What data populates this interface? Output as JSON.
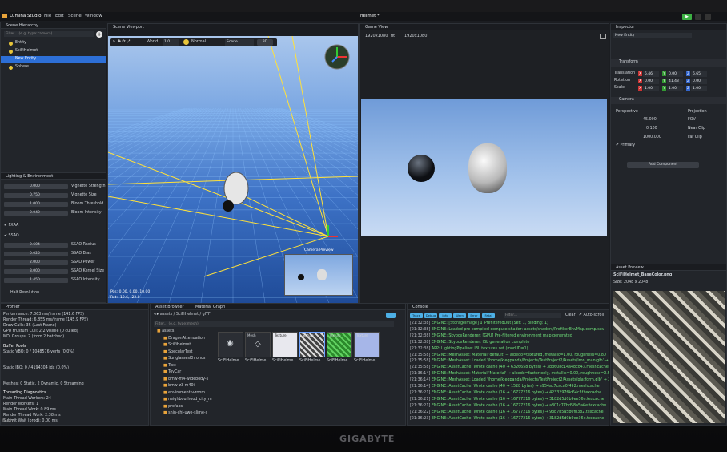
{
  "app": {
    "name": "Lumina Studio",
    "menu": [
      "File",
      "Edit",
      "Scene",
      "Window"
    ],
    "doc_title": "helmet *"
  },
  "hierarchy": {
    "title": "Scene Hierarchy",
    "search_placeholder": "Filter... (e.g. type:camera)",
    "items": [
      "Entity",
      "SciFiHelmet",
      "New Entity",
      "Sphere"
    ]
  },
  "viewport": {
    "title": "Scene Viewport",
    "mode": "World",
    "value": "1.0",
    "shading": "Normal",
    "view": "Scene",
    "dim": "3D",
    "camera_preview": "Camera Preview",
    "stats": [
      "Pos: 0.00, 0.00, 10.00",
      "Rot: -19.6, -22.0"
    ]
  },
  "gameview": {
    "title": "Game View",
    "res_label": "1920x1080",
    "fit": "fit",
    "res_value": "1920x1080"
  },
  "inspector": {
    "title": "Inspector",
    "entity": "New Entity",
    "transform": "Transform",
    "rows": [
      {
        "label": "Translation",
        "x": "5.46",
        "y": "0.00",
        "z": "6.65"
      },
      {
        "label": "Rotation",
        "x": "0.00",
        "y": "41.43",
        "z": "0.00"
      },
      {
        "label": "Scale",
        "x": "1.00",
        "y": "1.00",
        "z": "1.00"
      }
    ],
    "camera": "Camera",
    "perspective": "Perspective",
    "projection": "Projection",
    "cam_rows": [
      {
        "v": "45.000",
        "l": "FOV"
      },
      {
        "v": "0.100",
        "l": "Near Clip"
      },
      {
        "v": "1000.000",
        "l": "Far Clip"
      }
    ],
    "primary": "Primary",
    "add_component": "Add Component"
  },
  "lighting": {
    "title": "Lighting & Environment",
    "rows": [
      {
        "v": "0.000",
        "l": "Vignette Strength"
      },
      {
        "v": "0.750",
        "l": "Vignette Size"
      },
      {
        "v": "1.000",
        "l": "Bloom Threshold"
      },
      {
        "v": "0.040",
        "l": "Bloom Intensity"
      }
    ],
    "fxaa": "FXAA",
    "ssao": "SSAO",
    "ssao_rows": [
      {
        "v": "0.604",
        "l": "SSAO Radius"
      },
      {
        "v": "0.025",
        "l": "SSAO Bias"
      },
      {
        "v": "2.000",
        "l": "SSAO Power"
      },
      {
        "v": "3.000",
        "l": "SSAO Kernel Size"
      },
      {
        "v": "1.450",
        "l": "SSAO Intensity"
      }
    ],
    "half_res": "Half Resolution"
  },
  "profiler": {
    "title": "Profiler",
    "lines": [
      "Performance: 7.063 ms/frame (141.6 FPS)",
      "Render Thread: 6.855 ms/frame (145.9 FPS)",
      "Draw Calls: 35 (Last Frame)",
      "GPU Frustum Cull: 2/2 visible (0 culled)",
      "MDI Groups: 2 (from 2 batched)"
    ],
    "buffer_pools": "Buffer Pools",
    "static_vbo": "Static VBO: 0 / 1048576 verts (0.0%)",
    "static_ibo": "Static IBO: 0 / 4194304 idx (0.0%)",
    "meshes": "Meshes: 0 Static, 2 Dynamic, 0 Streaming",
    "threading": "Threading Diagnostics",
    "thread_lines": [
      "Main Thread Workers: 24",
      "Render Workers: 1",
      "Main Thread Work: 0.89 ms",
      "Render Thread Work: 2.38 ms",
      "Submit Wait (prod): 0.00 ms"
    ],
    "status": "Ready"
  },
  "assets": {
    "title": "Asset Browser",
    "tab2": "Material Graph",
    "path": [
      "assets",
      "SciFiHelmet",
      "glTF"
    ],
    "filter_placeholder": "Filter... (e.g. type:mesh)",
    "folders": [
      "assets",
      "DragonAttenuation",
      "SciFiHelmet",
      "SpecularTest",
      "SunglassesKhronos",
      "Text",
      "ToyCar",
      "bmw-m4-widebody-s",
      "bmw-z3-m40i",
      "enviroment-v-room",
      "neighbourhood_city_m",
      "prefabs",
      "shin-chi-uwe-slime-s"
    ],
    "files": [
      "SciFiHelme...",
      "SciFiHelme...",
      "SciFiHelme...",
      "SciFiHelme...",
      "SciFiHelme...",
      "SciFiHelme..."
    ],
    "thumb_tags": [
      "Mesh",
      "Texture",
      "Texture",
      "Texture",
      "Texture"
    ]
  },
  "console": {
    "title": "Console",
    "chips": [
      "Trace",
      "Debug",
      "Info",
      "Warn",
      "Error",
      "Fatal"
    ],
    "filter_placeholder": "Filter...",
    "clear": "Clear",
    "autoscroll": "Auto-scroll",
    "lines": [
      {
        "t": "[21:32:38]",
        "m": "ENGINE: [StorageImage] u_PrefilteredOut (Set: 1, Binding: 1)"
      },
      {
        "t": "[21:32:38]",
        "m": "ENGINE: Loaded pre-compiled compute shader: assets/shaders/PrefilterEnvMap.comp.spv"
      },
      {
        "t": "[21:32:38]",
        "m": "ENGINE: SkyboxRenderer: [GPU] Pre-filtered environment map generated"
      },
      {
        "t": "[21:32:38]",
        "m": "ENGINE: SkyboxRenderer: IBL generation complete"
      },
      {
        "t": "[21:32:38]",
        "m": "APP: LightingPipeline: IBL textures set (mod.ID=1)"
      },
      {
        "t": "[21:35:58]",
        "m": "ENGINE: MeshAsset: Material 'default' → albedo=textured, metallic=1.00, roughness=0.80"
      },
      {
        "t": "[21:35:58]",
        "m": "ENGINE: MeshAsset: Loaded '/home/klegpanda/Projects/TestProject2/Assets/iron_man.glb' → 127800 verti"
      },
      {
        "t": "[21:35:58]",
        "m": "ENGINE: AssetCache: Wrote cache (40 → 6326658 bytes) → 3bb608c14a48cd43.meshcache"
      },
      {
        "t": "[21:36:14]",
        "m": "ENGINE: MeshAsset: Material 'Material' → albedo=factor-only, metallic=0.00, roughness=0.50"
      },
      {
        "t": "[21:36:14]",
        "m": "ENGINE: MeshAsset: Loaded '/home/klegpanda/Projects/TestProject2/Assets/platform.glb' → 24 vertice"
      },
      {
        "t": "[21:36:14]",
        "m": "ENGINE: AssetCache: Wrote cache (40 → 1528 bytes) → e954ac7caca0f492.meshcache"
      },
      {
        "t": "[21:36:21]",
        "m": "ENGINE: AssetCache: Wrote cache (16 → 16777216 bytes) → 4233297f4c64c3f.texcache"
      },
      {
        "t": "[21:36:21]",
        "m": "ENGINE: AssetCache: Wrote cache (16 → 16777216 bytes) → 3182d5d0b9ee36e.texcache"
      },
      {
        "t": "[21:36:21]",
        "m": "ENGINE: AssetCache: Wrote cache (16 → 16777216 bytes) → a801c77bd58a5a6e.texcache"
      },
      {
        "t": "[21:36:22]",
        "m": "ENGINE: AssetCache: Wrote cache (16 → 16777216 bytes) → 93b7b5a5b0fb382.texcache"
      },
      {
        "t": "[21:36:23]",
        "m": "ENGINE: AssetCache: Wrote cache (16 → 16777216 bytes) → 3182d5d0b9ee36e.texcache"
      }
    ]
  },
  "preview": {
    "title": "Asset Preview",
    "file": "SciFiHelmet_BaseColor.png",
    "size": "Size: 2048 x 2048"
  },
  "monitor_brand": "GIGABYTE"
}
